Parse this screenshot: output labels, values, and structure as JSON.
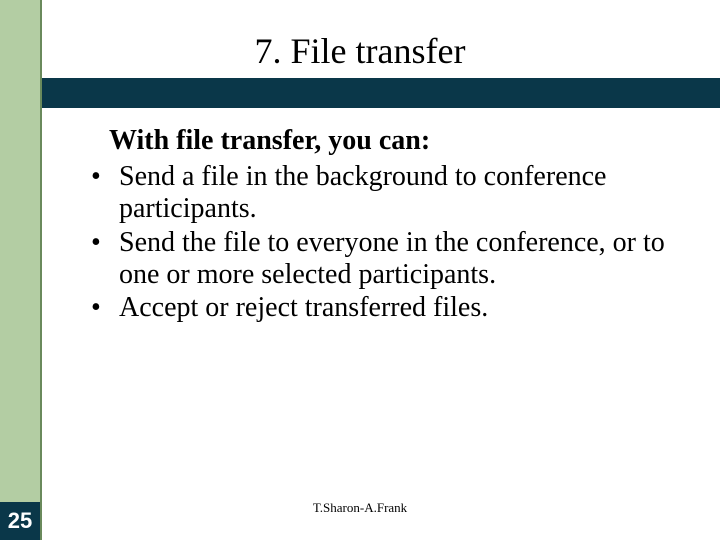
{
  "title": "7. File transfer",
  "lead": "With file transfer, you can:",
  "bullets": [
    "Send a file in the background to conference participants.",
    "Send the file to everyone in the conference, or to one or more selected participants.",
    "Accept or reject transferred files."
  ],
  "author": "T.Sharon-A.Frank",
  "page_number": "25"
}
